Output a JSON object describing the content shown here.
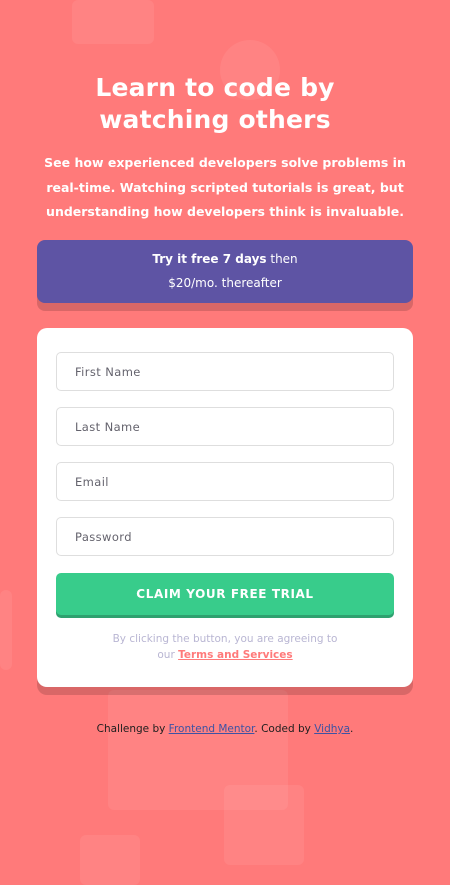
{
  "hero": {
    "title_line1": "Learn to code by",
    "title_line2": "watching others",
    "description": "See how experienced developers solve problems in real-time. Watching scripted tutorials is great, but understanding how developers think is invaluable."
  },
  "offer": {
    "bold_text": "Try it free 7 days",
    "text_after_bold": " then",
    "line2": "$20/mo. thereafter"
  },
  "form": {
    "first_name_placeholder": "First Name",
    "last_name_placeholder": "Last Name",
    "email_placeholder": "Email",
    "password_placeholder": "Password",
    "submit_label": "CLAIM YOUR FREE TRIAL",
    "terms_prefix": "By clicking the button, you are agreeing to",
    "terms_our": "our ",
    "terms_link": "Terms and Services"
  },
  "footer": {
    "prefix": "Challenge by ",
    "link1": "Frontend Mentor",
    "middle": ". Coded by ",
    "link2": "Vidhya",
    "suffix": "."
  },
  "colors": {
    "background": "#ff7a7a",
    "offer_bg": "#5e54a4",
    "button": "#38cc8b",
    "terms_link": "#ff7a7a"
  }
}
